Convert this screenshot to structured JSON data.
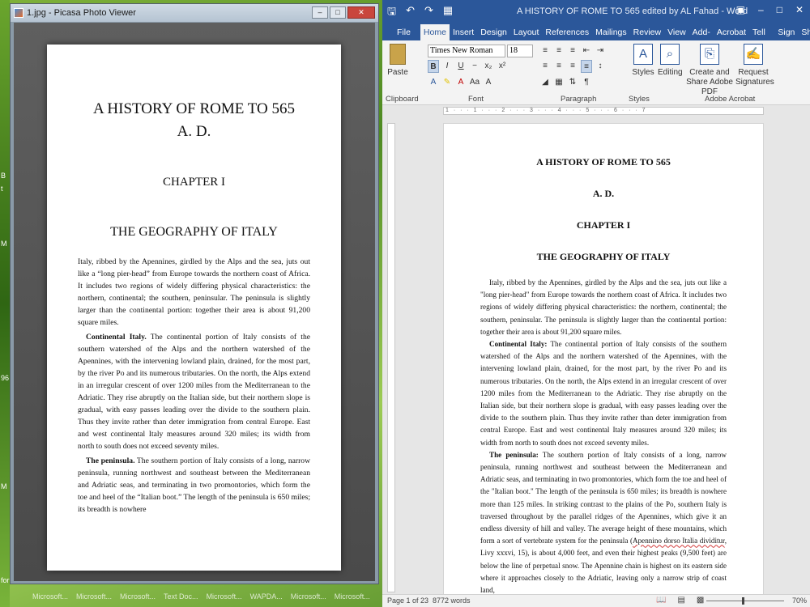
{
  "desktop": {
    "strip_labels": [
      "B",
      "t",
      "M",
      "96",
      "M",
      "for"
    ]
  },
  "picasa": {
    "title": "1.jpg - Picasa Photo Viewer",
    "doc": {
      "title_line1": "A HISTORY OF ROME TO 565",
      "title_line2": "A. D.",
      "chapter": "CHAPTER I",
      "heading": "THE GEOGRAPHY OF ITALY",
      "para1": "Italy, ribbed by the Apennines, girdled by the Alps and the sea, juts out like a “long pier-head” from Europe towards the northern coast of Africa.  It includes two regions of widely differing physical characteristics: the northern, continental; the southern, peninsular. The peninsula is slightly larger than the continental portion: together their area is about 91,200 square miles.",
      "para2_bold": "Continental Italy.",
      "para2": " The continental portion of Italy consists of the southern watershed of the Alps and the northern watershed of the Apennines, with the intervening lowland plain, drained, for the most part, by the river Po and its numerous tributaries.  On the north, the Alps extend in an irregular crescent of over 1200 miles from the Mediterranean to the Adriatic. They rise abruptly on the Italian side, but their northern slope is gradual, with easy passes leading over the divide to the southern plain.  Thus they invite rather than deter immigration from central Europe.  East and west continental Italy measures around 320 miles; its width from north to south does not exceed seventy miles.",
      "para3_bold": "The peninsula.",
      "para3": "  The southern portion of Italy consists of a long, narrow peninsula, running northwest and southeast between the Mediterranean and Adriatic seas, and terminating in two promontories, which form the toe and heel of the “Italian boot.”  The length of the peninsula is 650 miles; its breadth is nowhere"
    }
  },
  "taskbar": [
    "Microsoft...",
    "Microsoft...",
    "Microsoft...",
    "Text Doc...",
    "Microsoft...",
    "WAPDA...",
    "Microsoft...",
    "Microsoft..."
  ],
  "word": {
    "title": "A HISTORY OF ROME TO 565 edited by AL Fahad  -  Word",
    "tabs": [
      "File",
      "Home",
      "Insert",
      "Design",
      "Layout",
      "References",
      "Mailings",
      "Review",
      "View",
      "Add-Ins",
      "Acrobat",
      "Tell me...",
      "Sign in",
      "Share"
    ],
    "font_name": "Times New Roman",
    "font_size": "18",
    "paste_label": "Paste",
    "styles_label": "Styles",
    "editing_label": "Editing",
    "create_pdf_label": "Create and Share Adobe PDF",
    "request_sig_label": "Request Signatures",
    "groups": [
      "Clipboard",
      "Font",
      "Paragraph",
      "Styles",
      "Adobe Acrobat"
    ],
    "ruler_text": "1 · · · 1 · · · 2 · · · 3 · · · 4 · · · 5 · · · 6 · · · 7",
    "doc": {
      "h1": "A HISTORY OF ROME TO 565",
      "h2": "A. D.",
      "h3": "CHAPTER I",
      "h4": "THE GEOGRAPHY OF ITALY",
      "p1": "Italy, ribbed by the Apennines, girdled by the Alps and the sea, juts out like a \"long pier-head\" from Europe towards the northern coast of Africa. It includes two regions of widely differing physical characteristics: the northern, continental; the southern, peninsular. The peninsula is slightly larger than the continental portion: together their area is about 91,200 square miles.",
      "p2_bold": "Continental Italy:",
      "p2": " The continental portion of Italy consists of the southern watershed of the Alps and the northern watershed of the Apennines, with the intervening lowland plain, drained, for the most part, by the river Po and its numerous tributaries. On the north, the Alps extend in an irregular crescent of over 1200 miles from the Mediterranean to the Adriatic. They rise abruptly on the Italian side, but their northern slope is gradual, with easy passes leading over the divide to the southern plain. Thus they invite rather than deter immigration from central Europe. East and west continental Italy measures around 320 miles; its width from north to south does not exceed seventy miles.",
      "p3_bold": "The peninsula:",
      "p3a": " The southern portion of Italy consists of a long, narrow peninsula, running northwest and southeast between the Mediterranean and Adriatic seas, and terminating in two promontories, which form the toe and heel of the \"Italian boot.\" The length of the peninsula is 650 miles; its breadth is nowhere more than 125 miles. In striking contrast to the plains of the Po, southern Italy is traversed throughout by the parallel ridges of the Apennines, which give it an endless diversity of hill and valley. The average height of these mountains, which form a sort of vertebrate system for the peninsula (",
      "p3_latin": "Apennino dorso Italia dividitur",
      "p3b": ", Livy xxxvi, 15), is about 4,000 feet, and even their highest peaks (9,500 feet) are below the line of perpetual snow. The Apennine chain is highest on its eastern side where it approaches closely to the Adriatic, leaving only a narrow strip of coast land,"
    },
    "status": {
      "page": "Page 1 of 23",
      "words": "8772 words",
      "zoom": "70%"
    }
  }
}
